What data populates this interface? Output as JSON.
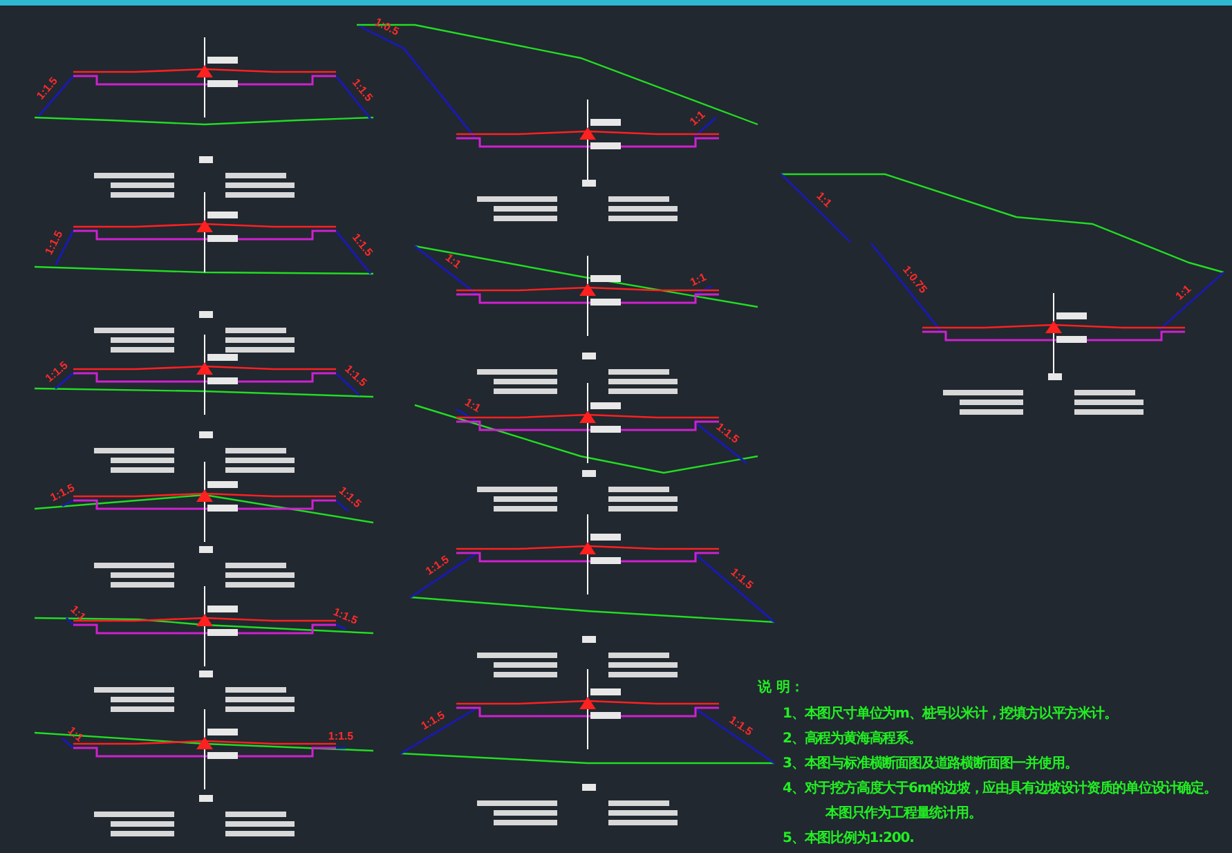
{
  "drawing": {
    "sections": [
      {
        "slope_labels": [
          "1:1.5",
          "1:1.5"
        ]
      },
      {
        "slope_labels": [
          "1:1.5",
          "1:1.5"
        ]
      },
      {
        "slope_labels": [
          "1:1.5",
          "1:1.5"
        ]
      },
      {
        "slope_labels": [
          "1:1.5",
          "1:1.5"
        ]
      },
      {
        "slope_labels": [
          "1:1",
          "1:1.5"
        ]
      },
      {
        "slope_labels": [
          "1:1",
          "1:1.5"
        ]
      },
      {
        "slope_labels": [
          "1:0.5",
          "1:1"
        ]
      },
      {
        "slope_labels": [
          "1:1",
          "1:1"
        ]
      },
      {
        "slope_labels": [
          "1:1",
          "1:1.5"
        ]
      },
      {
        "slope_labels": [
          "1:1.5",
          "1:1.5"
        ]
      },
      {
        "slope_labels": [
          "1:1.5",
          "1:1.5"
        ]
      },
      {
        "slope_labels": [
          "1:1",
          "1:0.75",
          "1:1"
        ]
      }
    ]
  },
  "notes": {
    "title": "说  明：",
    "items": [
      {
        "kind": "item",
        "text": "1、本图尺寸单位为m、桩号以米计，挖填方以平方米计。"
      },
      {
        "kind": "item",
        "text": "2、高程为黄海高程系。"
      },
      {
        "kind": "item",
        "text": "3、本图与标准横断面图及道路横断面图一并使用。"
      },
      {
        "kind": "item",
        "text": "4、对于挖方高度大于6m的边坡，应由具有边坡设计资质的单位设计确定。"
      },
      {
        "kind": "continuation",
        "text": "本图只作为工程量统计用。"
      },
      {
        "kind": "item",
        "text": "5、本图比例为1:200."
      }
    ]
  }
}
